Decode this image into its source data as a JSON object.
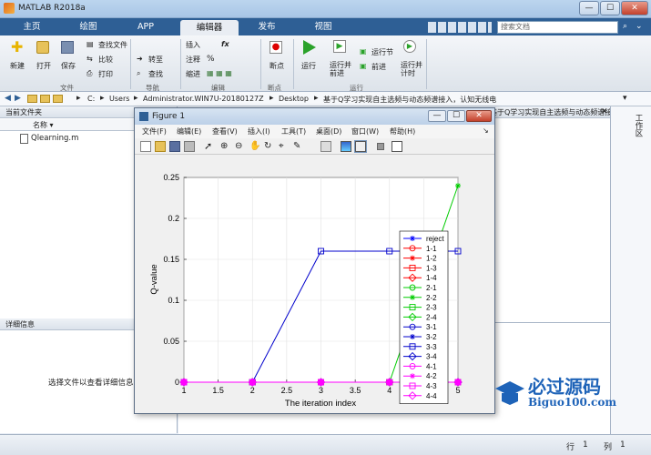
{
  "window": {
    "title": "MATLAB R2018a",
    "min": "—",
    "max": "☐",
    "close": "✕"
  },
  "tabs": [
    {
      "label": "主页"
    },
    {
      "label": "绘图"
    },
    {
      "label": "APP"
    },
    {
      "label": "编辑器",
      "active": true
    },
    {
      "label": "发布"
    },
    {
      "label": "视图"
    }
  ],
  "search": {
    "placeholder": "搜索文档"
  },
  "ribbon": {
    "new": "新建",
    "open": "打开",
    "save": "保存",
    "find_file": "查找文件",
    "compare": "比较",
    "print": "打印",
    "group_file": "文件",
    "goto": "转至",
    "find": "查找",
    "group_nav": "导航",
    "insert": "插入",
    "comment": "注释",
    "indent": "缩进",
    "fx": "fx",
    "group_edit": "编辑",
    "breakpoints": "断点",
    "group_bp": "断点",
    "run": "运行",
    "run_advance": "运行并\n前进",
    "run_section": "运行节",
    "advance": "前进",
    "run_time": "运行并\n计时",
    "group_run": "运行"
  },
  "address": {
    "path": [
      "C:",
      "Users",
      "Administrator.WIN7U-20180127Z",
      "Desktop",
      "基于Q学习实现自主选频与动态频谱接入，认知无线电"
    ]
  },
  "left_panel": {
    "title": "当前文件夹",
    "col_name": "名称",
    "file": "Qlearning.m",
    "detail_title": "详细信息",
    "detail_hint": "选择文件以查看详细信息"
  },
  "editor": {
    "tab_title": "基于Q学习实现自主选频与动态频谱接入，认知无线电..."
  },
  "workspace": {
    "title": "工作区"
  },
  "status": {
    "row_label": "行",
    "row": "1",
    "col_label": "列",
    "col": "1"
  },
  "figure": {
    "title": "Figure 1",
    "menu": [
      "文件(F)",
      "编辑(E)",
      "查看(V)",
      "插入(I)",
      "工具(T)",
      "桌面(D)",
      "窗口(W)",
      "帮助(H)"
    ]
  },
  "logo": {
    "name": "必过源码",
    "url": "Biguo100.com"
  },
  "chart_data": {
    "type": "line",
    "xlabel": "The iteration index",
    "ylabel": "Q-value",
    "xlim": [
      1,
      5
    ],
    "ylim": [
      0,
      0.25
    ],
    "xticks": [
      1,
      1.5,
      2,
      2.5,
      3,
      3.5,
      4,
      4.5,
      5
    ],
    "yticks": [
      0,
      0.05,
      0.1,
      0.15,
      0.2,
      0.25
    ],
    "grid": true,
    "legend_position": "top-right",
    "x": [
      1,
      2,
      3,
      4,
      5
    ],
    "series": [
      {
        "name": "reject",
        "values": [
          0,
          0,
          0,
          0,
          0
        ],
        "color": "#0000ff",
        "marker": "star"
      },
      {
        "name": "1-1",
        "values": [
          0,
          0,
          0,
          0,
          0
        ],
        "color": "#ff0000",
        "marker": "circle"
      },
      {
        "name": "1-2",
        "values": [
          0,
          0,
          0,
          0,
          0
        ],
        "color": "#ff0000",
        "marker": "star"
      },
      {
        "name": "1-3",
        "values": [
          0,
          0,
          0,
          0,
          0
        ],
        "color": "#ff0000",
        "marker": "square"
      },
      {
        "name": "1-4",
        "values": [
          0,
          0,
          0,
          0,
          0
        ],
        "color": "#ff0000",
        "marker": "diamond"
      },
      {
        "name": "2-1",
        "values": [
          0,
          0,
          0,
          0,
          0
        ],
        "color": "#00cc00",
        "marker": "circle"
      },
      {
        "name": "2-2",
        "values": [
          0,
          0,
          0,
          0,
          0.24
        ],
        "color": "#00cc00",
        "marker": "star"
      },
      {
        "name": "2-3",
        "values": [
          0,
          0,
          0,
          0,
          0
        ],
        "color": "#00cc00",
        "marker": "square"
      },
      {
        "name": "2-4",
        "values": [
          0,
          0,
          0,
          0,
          0
        ],
        "color": "#00cc00",
        "marker": "diamond"
      },
      {
        "name": "3-1",
        "values": [
          0,
          0,
          0,
          0,
          0
        ],
        "color": "#0000cc",
        "marker": "circle"
      },
      {
        "name": "3-2",
        "values": [
          0,
          0,
          0,
          0,
          0
        ],
        "color": "#0000cc",
        "marker": "star"
      },
      {
        "name": "3-3",
        "values": [
          0,
          0,
          0.16,
          0.16,
          0.16
        ],
        "color": "#0000cc",
        "marker": "square"
      },
      {
        "name": "3-4",
        "values": [
          0,
          0,
          0,
          0,
          0
        ],
        "color": "#0000cc",
        "marker": "diamond"
      },
      {
        "name": "4-1",
        "values": [
          0,
          0,
          0,
          0,
          0
        ],
        "color": "#ff00ff",
        "marker": "circle"
      },
      {
        "name": "4-2",
        "values": [
          0,
          0,
          0,
          0,
          0
        ],
        "color": "#ff00ff",
        "marker": "star"
      },
      {
        "name": "4-3",
        "values": [
          0,
          0,
          0,
          0,
          0
        ],
        "color": "#ff00ff",
        "marker": "square"
      },
      {
        "name": "4-4",
        "values": [
          0,
          0,
          0,
          0,
          0
        ],
        "color": "#ff00ff",
        "marker": "diamond"
      }
    ]
  }
}
